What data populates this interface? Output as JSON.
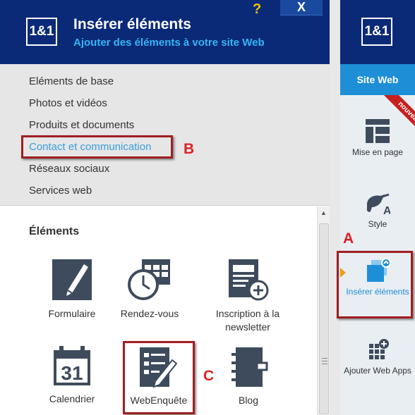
{
  "header": {
    "logo": "1&1",
    "title": "Insérer éléments",
    "subtitle": "Ajouter des éléments à votre site Web",
    "help": "?",
    "close": "X"
  },
  "categories": [
    {
      "label": "Eléments de base",
      "selected": false
    },
    {
      "label": "Photos et vidéos",
      "selected": false
    },
    {
      "label": "Produits et documents",
      "selected": false
    },
    {
      "label": "Contact et communication",
      "selected": true
    },
    {
      "label": "Réseaux sociaux",
      "selected": false
    },
    {
      "label": "Services web",
      "selected": false
    }
  ],
  "elements": {
    "heading": "Éléments",
    "items": [
      {
        "label": "Formulaire",
        "icon": "pencil-icon"
      },
      {
        "label": "Rendez-vous",
        "icon": "clock-calendar-icon"
      },
      {
        "label": "Inscription à la newsletter",
        "icon": "newsletter-add-icon"
      },
      {
        "label": "Calendrier",
        "icon": "calendar-icon"
      },
      {
        "label": "WebEnquête",
        "icon": "survey-icon"
      },
      {
        "label": "Blog",
        "icon": "notebook-icon"
      }
    ],
    "calendar_day": "31"
  },
  "sidebar": {
    "logo": "1&1",
    "site": "Site Web",
    "ribbon": "nouveau",
    "items": [
      {
        "label": "Mise en page",
        "icon": "layout-icon"
      },
      {
        "label": "Style",
        "icon": "brush-style-icon"
      },
      {
        "label": "Insérer éléments",
        "icon": "insert-elements-icon",
        "active": true
      },
      {
        "label": "Ajouter Web Apps",
        "icon": "add-apps-icon"
      }
    ]
  },
  "annotations": {
    "a": "A",
    "b": "B",
    "c": "C"
  },
  "colors": {
    "header": "#0a2a78",
    "accent": "#37b6f5",
    "selected": "#3a9de0",
    "annotation": "#a01e22",
    "icon": "#3e4b5c"
  }
}
